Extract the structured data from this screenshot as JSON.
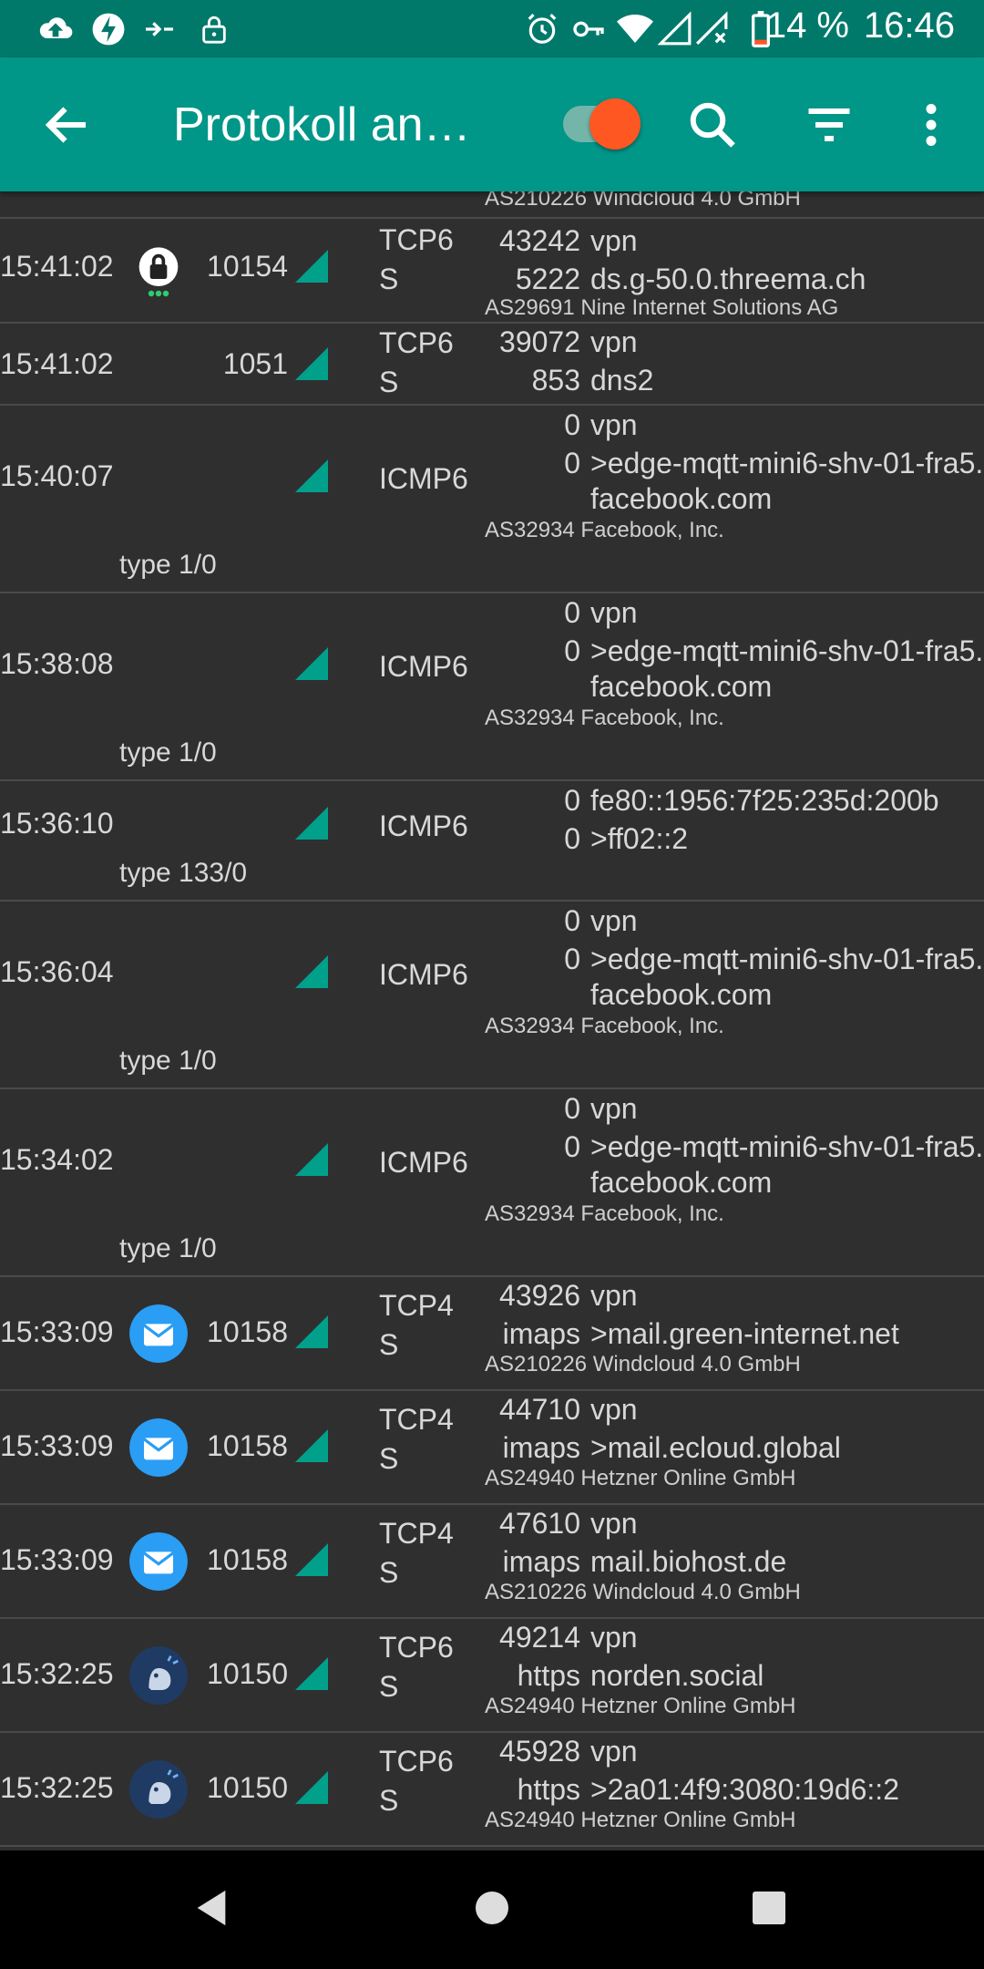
{
  "status": {
    "battery": "14 %",
    "time": "16:46"
  },
  "appbar": {
    "title": "Protokoll an…",
    "back": "back-arrow",
    "toggle_on": true
  },
  "rows": [
    {
      "time": "",
      "uid": "",
      "proto": "",
      "port1": "",
      "dest1": "",
      "port2": "",
      "dest2": "",
      "dest3": "",
      "as": "AS210226 Windcloud 4.0 GmbH",
      "type": ""
    },
    {
      "time": "15:41:02",
      "uid": "10154",
      "proto": "TCP6\nS",
      "port1": "43242",
      "dest1": "vpn",
      "port2": "5222",
      "dest2": "ds.g-50.0.threema.ch",
      "dest3": "",
      "as": "AS29691 Nine Internet Solutions AG",
      "type": ""
    },
    {
      "time": "15:41:02",
      "uid": "1051",
      "proto": "TCP6\nS",
      "port1": "39072",
      "dest1": "vpn",
      "port2": "853",
      "dest2": "dns2",
      "dest3": "",
      "as": "",
      "type": ""
    },
    {
      "time": "15:40:07",
      "uid": "",
      "proto": "ICMP6",
      "port1": "0",
      "dest1": "vpn",
      "port2": "0",
      "dest2": ">edge-mqtt-mini6-shv-01-fra5.",
      "dest3": "facebook.com",
      "as": "AS32934 Facebook, Inc.",
      "type": "type 1/0"
    },
    {
      "time": "15:38:08",
      "uid": "",
      "proto": "ICMP6",
      "port1": "0",
      "dest1": "vpn",
      "port2": "0",
      "dest2": ">edge-mqtt-mini6-shv-01-fra5.",
      "dest3": "facebook.com",
      "as": "AS32934 Facebook, Inc.",
      "type": "type 1/0"
    },
    {
      "time": "15:36:10",
      "uid": "",
      "proto": "ICMP6",
      "port1": "0",
      "dest1": "fe80::1956:7f25:235d:200b",
      "port2": "0",
      "dest2": ">ff02::2",
      "dest3": "",
      "as": "",
      "type": "type 133/0"
    },
    {
      "time": "15:36:04",
      "uid": "",
      "proto": "ICMP6",
      "port1": "0",
      "dest1": "vpn",
      "port2": "0",
      "dest2": ">edge-mqtt-mini6-shv-01-fra5.",
      "dest3": "facebook.com",
      "as": "AS32934 Facebook, Inc.",
      "type": "type 1/0"
    },
    {
      "time": "15:34:02",
      "uid": "",
      "proto": "ICMP6",
      "port1": "0",
      "dest1": "vpn",
      "port2": "0",
      "dest2": ">edge-mqtt-mini6-shv-01-fra5.",
      "dest3": "facebook.com",
      "as": "AS32934 Facebook, Inc.",
      "type": "type 1/0"
    },
    {
      "time": "15:33:09",
      "uid": "10158",
      "proto": "TCP4\nS",
      "port1": "43926",
      "dest1": "vpn",
      "port2": "imaps",
      "dest2": ">mail.green-internet.net",
      "dest3": "",
      "as": "AS210226 Windcloud 4.0 GmbH",
      "type": ""
    },
    {
      "time": "15:33:09",
      "uid": "10158",
      "proto": "TCP4\nS",
      "port1": "44710",
      "dest1": "vpn",
      "port2": "imaps",
      "dest2": ">mail.ecloud.global",
      "dest3": "",
      "as": "AS24940 Hetzner Online GmbH",
      "type": ""
    },
    {
      "time": "15:33:09",
      "uid": "10158",
      "proto": "TCP4\nS",
      "port1": "47610",
      "dest1": "vpn",
      "port2": "imaps",
      "dest2": "mail.biohost.de",
      "dest3": "",
      "as": "AS210226 Windcloud 4.0 GmbH",
      "type": ""
    },
    {
      "time": "15:32:25",
      "uid": "10150",
      "proto": "TCP6\nS",
      "port1": "49214",
      "dest1": "vpn",
      "port2": "https",
      "dest2": "norden.social",
      "dest3": "",
      "as": "AS24940 Hetzner Online GmbH",
      "type": ""
    },
    {
      "time": "15:32:25",
      "uid": "10150",
      "proto": "TCP6\nS",
      "port1": "45928",
      "dest1": "vpn",
      "port2": "https",
      "dest2": ">2a01:4f9:3080:19d6::2",
      "dest3": "",
      "as": "AS24940 Hetzner Online GmbH",
      "type": ""
    }
  ],
  "row_icons": [
    "",
    "threema-lock-icon",
    "",
    "",
    "",
    "",
    "",
    "",
    "mail-app-icon",
    "mail-app-icon",
    "mail-app-icon",
    "mastodon-app-icon",
    "mastodon-app-icon"
  ],
  "colors": {
    "statusbar": "#00796b",
    "appbar": "#009688",
    "toggle_thumb": "#ff5722",
    "signal": "#00a08a",
    "mail": "#2a9df4",
    "mastodon": "#1f3b63",
    "background": "#2f2f2f"
  }
}
